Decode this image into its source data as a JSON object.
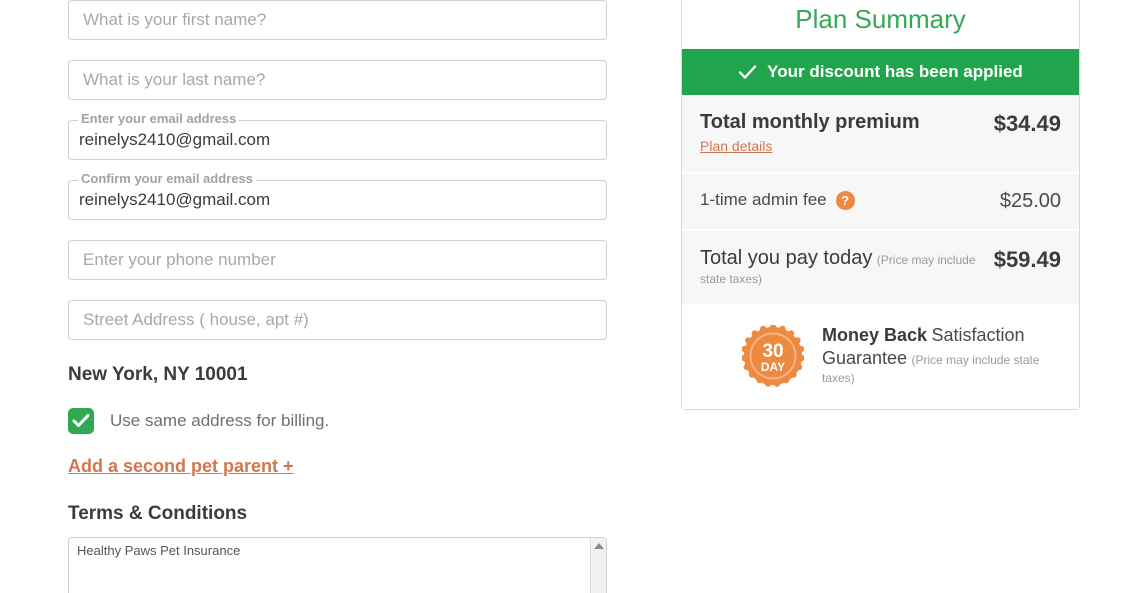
{
  "form": {
    "fields": [
      {
        "name": "first-name",
        "placeholder": "What is your first name?",
        "value": "",
        "label": ""
      },
      {
        "name": "last-name",
        "placeholder": "What is your last name?",
        "value": "",
        "label": ""
      },
      {
        "name": "email",
        "placeholder": "",
        "value": "reinelys2410@gmail.com",
        "label": "Enter your email address"
      },
      {
        "name": "confirm-email",
        "placeholder": "",
        "value": "reinelys2410@gmail.com",
        "label": "Confirm your email address"
      },
      {
        "name": "phone",
        "placeholder": "Enter your phone number",
        "value": "",
        "label": ""
      },
      {
        "name": "street",
        "placeholder": "Street Address ( house, apt #)",
        "value": "",
        "label": ""
      }
    ],
    "city_state_zip": "New York, NY 10001",
    "billing_checkbox_label": "Use same address for billing.",
    "billing_checked": true,
    "add_second_parent": "Add a second pet parent +",
    "terms_title": "Terms & Conditions",
    "terms_text": "Healthy Paws Pet Insurance"
  },
  "summary": {
    "title": "Plan Summary",
    "discount_banner": "Your discount has been applied",
    "rows": [
      {
        "name": "total-monthly-premium",
        "label": "Total monthly premium",
        "link": "Plan details",
        "price": "$34.49"
      },
      {
        "name": "admin-fee",
        "label": "1-time admin fee",
        "help": "?",
        "price": "$25.00"
      },
      {
        "name": "total-today",
        "label": "Total you pay today",
        "sub": "(Price may include state taxes)",
        "price": "$59.49"
      }
    ],
    "guarantee": {
      "badge_number": "30",
      "badge_unit": "DAY",
      "line1": "Money Back",
      "line2": "Satisfaction Guarantee",
      "line3": "(Price may include state taxes)"
    }
  },
  "colors": {
    "green": "#21a54c",
    "green_title": "#35a853",
    "orange": "#ee8a3f",
    "link_orange": "#d2764f",
    "checkbox_green": "#32a852"
  }
}
